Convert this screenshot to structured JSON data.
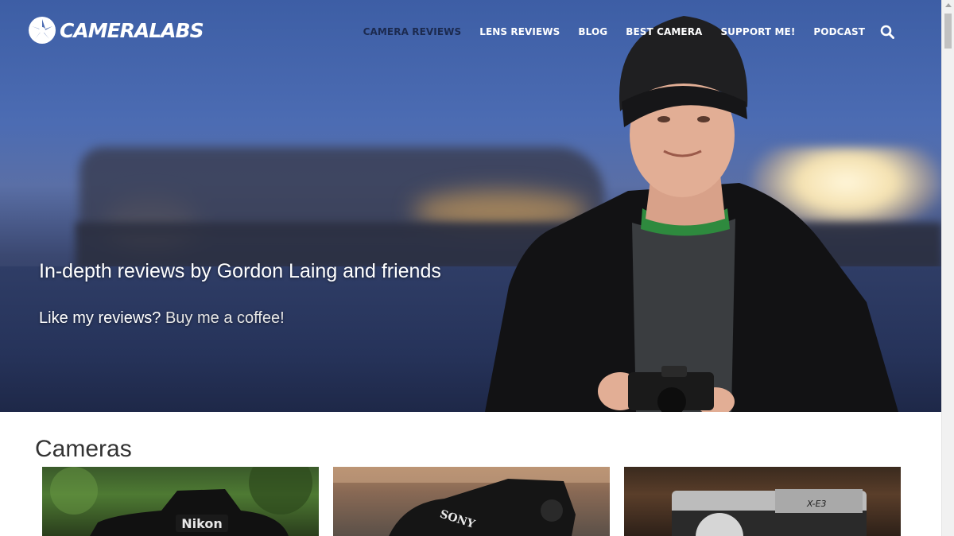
{
  "header": {
    "logo_text": "CAMERALABS",
    "nav": [
      {
        "label": "CAMERA REVIEWS",
        "active": true
      },
      {
        "label": "LENS REVIEWS",
        "active": false
      },
      {
        "label": "BLOG",
        "active": false
      },
      {
        "label": "BEST CAMERA",
        "active": false
      },
      {
        "label": "SUPPORT ME!",
        "active": false
      },
      {
        "label": "PODCAST",
        "active": false
      }
    ],
    "search_icon": "search-icon"
  },
  "hero": {
    "tagline": "In-depth reviews by Gordon Laing and friends",
    "cta_prefix": "Like my reviews?",
    "cta_link": "Buy me a coffee!"
  },
  "cameras": {
    "title": "Cameras",
    "cards": [
      {
        "brand_text": "Nikon"
      },
      {
        "brand_text": "SONY"
      },
      {
        "brand_text": "X-E3"
      }
    ]
  },
  "colors": {
    "active_nav": "#1c2a4f",
    "hero_sky": "#4c6cb3"
  }
}
